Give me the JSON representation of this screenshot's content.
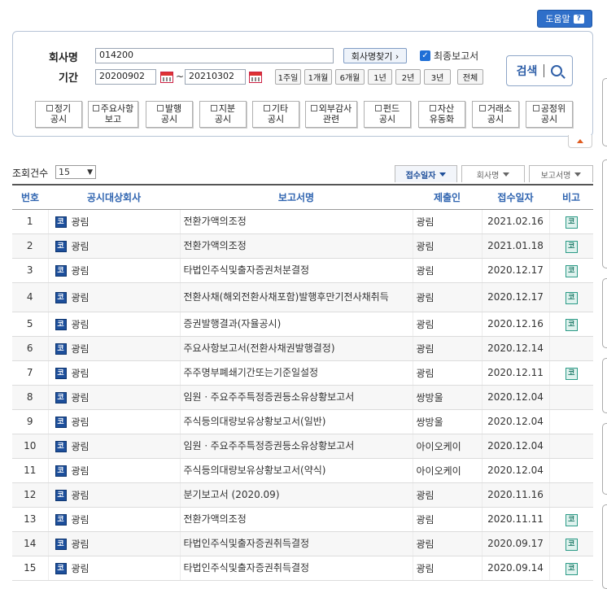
{
  "help": {
    "label": "도움말"
  },
  "search": {
    "company_label": "회사명",
    "company_value": "014200",
    "find_company_label": "회사명찾기 ›",
    "final_report_label": "최종보고서",
    "final_report_checked": true,
    "period_label": "기간",
    "start_date": "20200902",
    "end_date": "20210302",
    "period_separator": "~",
    "period_buttons": [
      "1주일",
      "1개월",
      "6개월",
      "1년",
      "2년",
      "3년",
      "전체"
    ],
    "search_button": "검색",
    "categories": [
      [
        "정기",
        "공시"
      ],
      [
        "주요사항",
        "보고"
      ],
      [
        "발행",
        "공시"
      ],
      [
        "지분",
        "공시"
      ],
      [
        "기타",
        "공시"
      ],
      [
        "외부감사",
        "관련"
      ],
      [
        "펀드",
        "공시"
      ],
      [
        "자산",
        "유동화"
      ],
      [
        "거래소",
        "공시"
      ],
      [
        "공정위",
        "공시"
      ]
    ]
  },
  "list_controls": {
    "count_label": "조회건수",
    "count_value": "15",
    "sort_buttons": [
      "접수일자",
      "회사명",
      "보고서명"
    ],
    "active_sort": "접수일자"
  },
  "table": {
    "columns": [
      "번호",
      "공시대상회사",
      "보고서명",
      "제출인",
      "접수일자",
      "비고"
    ],
    "market_icon": "코",
    "note_icon": "코",
    "rows": [
      {
        "no": "1",
        "company": "광림",
        "report": "전환가액의조정",
        "submitter": "광림",
        "date": "2021.02.16",
        "note": true
      },
      {
        "no": "2",
        "company": "광림",
        "report": "전환가액의조정",
        "submitter": "광림",
        "date": "2021.01.18",
        "note": true
      },
      {
        "no": "3",
        "company": "광림",
        "report": "타법인주식및출자증권처분결정",
        "submitter": "광림",
        "date": "2020.12.17",
        "note": true
      },
      {
        "no": "4",
        "company": "광림",
        "report": "전환사채(해외전환사채포함)발행후만기전사채취득",
        "submitter": "광림",
        "date": "2020.12.17",
        "note": true
      },
      {
        "no": "5",
        "company": "광림",
        "report": "증권발행결과(자율공시)",
        "submitter": "광림",
        "date": "2020.12.16",
        "note": true
      },
      {
        "no": "6",
        "company": "광림",
        "report": "주요사항보고서(전환사채권발행결정)",
        "submitter": "광림",
        "date": "2020.12.14",
        "note": false
      },
      {
        "no": "7",
        "company": "광림",
        "report": "주주명부폐쇄기간또는기준일설정",
        "submitter": "광림",
        "date": "2020.12.11",
        "note": true
      },
      {
        "no": "8",
        "company": "광림",
        "report": "임원ㆍ주요주주특정증권등소유상황보고서",
        "submitter": "쌍방울",
        "date": "2020.12.04",
        "note": false
      },
      {
        "no": "9",
        "company": "광림",
        "report": "주식등의대량보유상황보고서(일반)",
        "submitter": "쌍방울",
        "date": "2020.12.04",
        "note": false
      },
      {
        "no": "10",
        "company": "광림",
        "report": "임원ㆍ주요주주특정증권등소유상황보고서",
        "submitter": "아이오케이",
        "date": "2020.12.04",
        "note": false
      },
      {
        "no": "11",
        "company": "광림",
        "report": "주식등의대량보유상황보고서(약식)",
        "submitter": "아이오케이",
        "date": "2020.12.04",
        "note": false
      },
      {
        "no": "12",
        "company": "광림",
        "report": "분기보고서 (2020.09)",
        "submitter": "광림",
        "date": "2020.11.16",
        "note": false
      },
      {
        "no": "13",
        "company": "광림",
        "report": "전환가액의조정",
        "submitter": "광림",
        "date": "2020.11.11",
        "note": true
      },
      {
        "no": "14",
        "company": "광림",
        "report": "타법인주식및출자증권취득결정",
        "submitter": "광림",
        "date": "2020.09.17",
        "note": true
      },
      {
        "no": "15",
        "company": "광림",
        "report": "타법인주식및출자증권취득결정",
        "submitter": "광림",
        "date": "2020.09.14",
        "note": true
      }
    ]
  }
}
